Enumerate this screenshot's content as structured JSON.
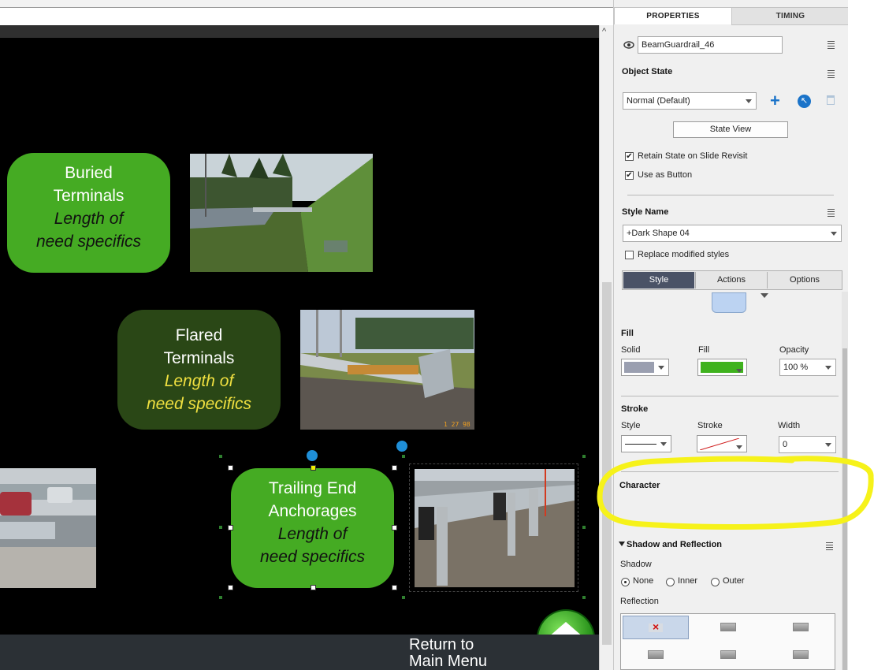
{
  "stage": {
    "buttons": [
      {
        "title1": "Buried",
        "title2": "Terminals",
        "sub1": "Length of",
        "sub2": "need specifics"
      },
      {
        "title1": "Flared",
        "title2": "Terminals",
        "sub1": "Length of",
        "sub2": "need specifics"
      },
      {
        "title1": "Trailing End",
        "title2": "Anchorages",
        "sub1": "Length of",
        "sub2": "need specifics"
      }
    ],
    "photos": [
      "buried-terminal-photo",
      "flared-terminal-photo",
      "trailing-end-photo",
      "highway-guardrail-photo"
    ],
    "return_label_1": "Return to",
    "return_label_2": "Main Menu",
    "photo_date": "1 27 98"
  },
  "panel": {
    "tabs": [
      "PROPERTIES",
      "TIMING"
    ],
    "object_name": "BeamGuardrail_46",
    "object_state_header": "Object State",
    "state_value": "Normal (Default)",
    "state_view_button": "State View",
    "retain_state": "Retain State on Slide Revisit",
    "use_as_button": "Use as Button",
    "style_name_header": "Style Name",
    "style_name_value": "+Dark Shape 04",
    "replace_modified": "Replace modified styles",
    "subtabs": [
      "Style",
      "Actions",
      "Options"
    ],
    "fill": {
      "header": "Fill",
      "solid_label": "Solid",
      "fill_label": "Fill",
      "opacity_label": "Opacity",
      "opacity_value": "100 %",
      "fill_color": "#3fb21e",
      "solid_color": "#9a9fb0"
    },
    "stroke": {
      "header": "Stroke",
      "style_label": "Style",
      "stroke_label": "Stroke",
      "width_label": "Width",
      "width_value": "0"
    },
    "character_header": "Character",
    "shadow": {
      "header": "Shadow and Reflection",
      "shadow_label": "Shadow",
      "options": [
        "None",
        "Inner",
        "Outer"
      ],
      "selected": "None",
      "reflection_label": "Reflection"
    }
  },
  "colors": {
    "accent_green": "#45ab23",
    "dark_green": "#2a4716",
    "highlight": "#f6f21a",
    "panel_bg": "#f0f0f0",
    "tab_active": "#4a5266"
  }
}
